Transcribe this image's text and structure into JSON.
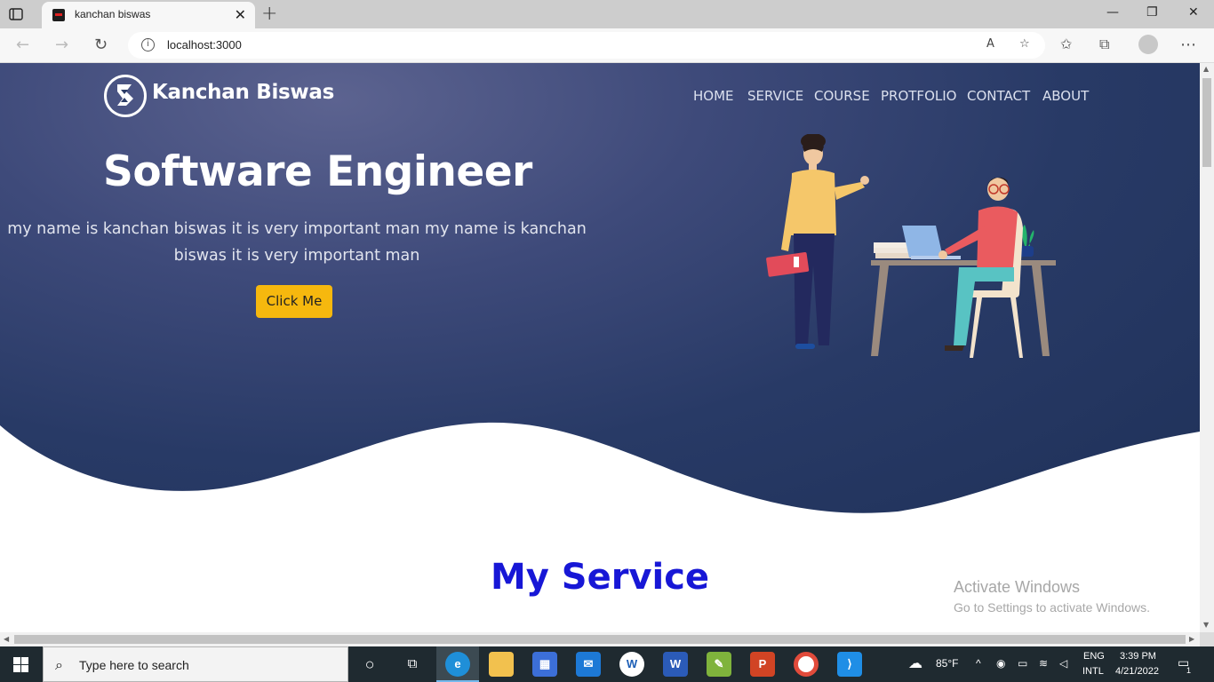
{
  "browser": {
    "tab_title": "kanchan biswas",
    "url": "localhost:3000"
  },
  "site": {
    "logo_text": "Kanchan Biswas",
    "nav": [
      "HOME",
      "SERVICE",
      "COURSE",
      "PROTFOLIO",
      "CONTACT",
      "ABOUT"
    ],
    "hero_title": "Software Engineer",
    "hero_desc": "my name is kanchan biswas it is very important man my name is kanchan biswas it is very important man",
    "cta_label": "Click Me",
    "service_title": "My Service"
  },
  "watermark": {
    "line1": "Activate Windows",
    "line2": "Go to Settings to activate Windows."
  },
  "taskbar": {
    "search_placeholder": "Type here to search",
    "weather_temp": "85°F",
    "lang_top": "ENG",
    "lang_bottom": "INTL",
    "time": "3:39 PM",
    "date": "4/21/2022",
    "notif_count": "1"
  },
  "colors": {
    "hero_dark": "#1f3159",
    "cta": "#f6b80e",
    "service_title": "#1717d6"
  }
}
